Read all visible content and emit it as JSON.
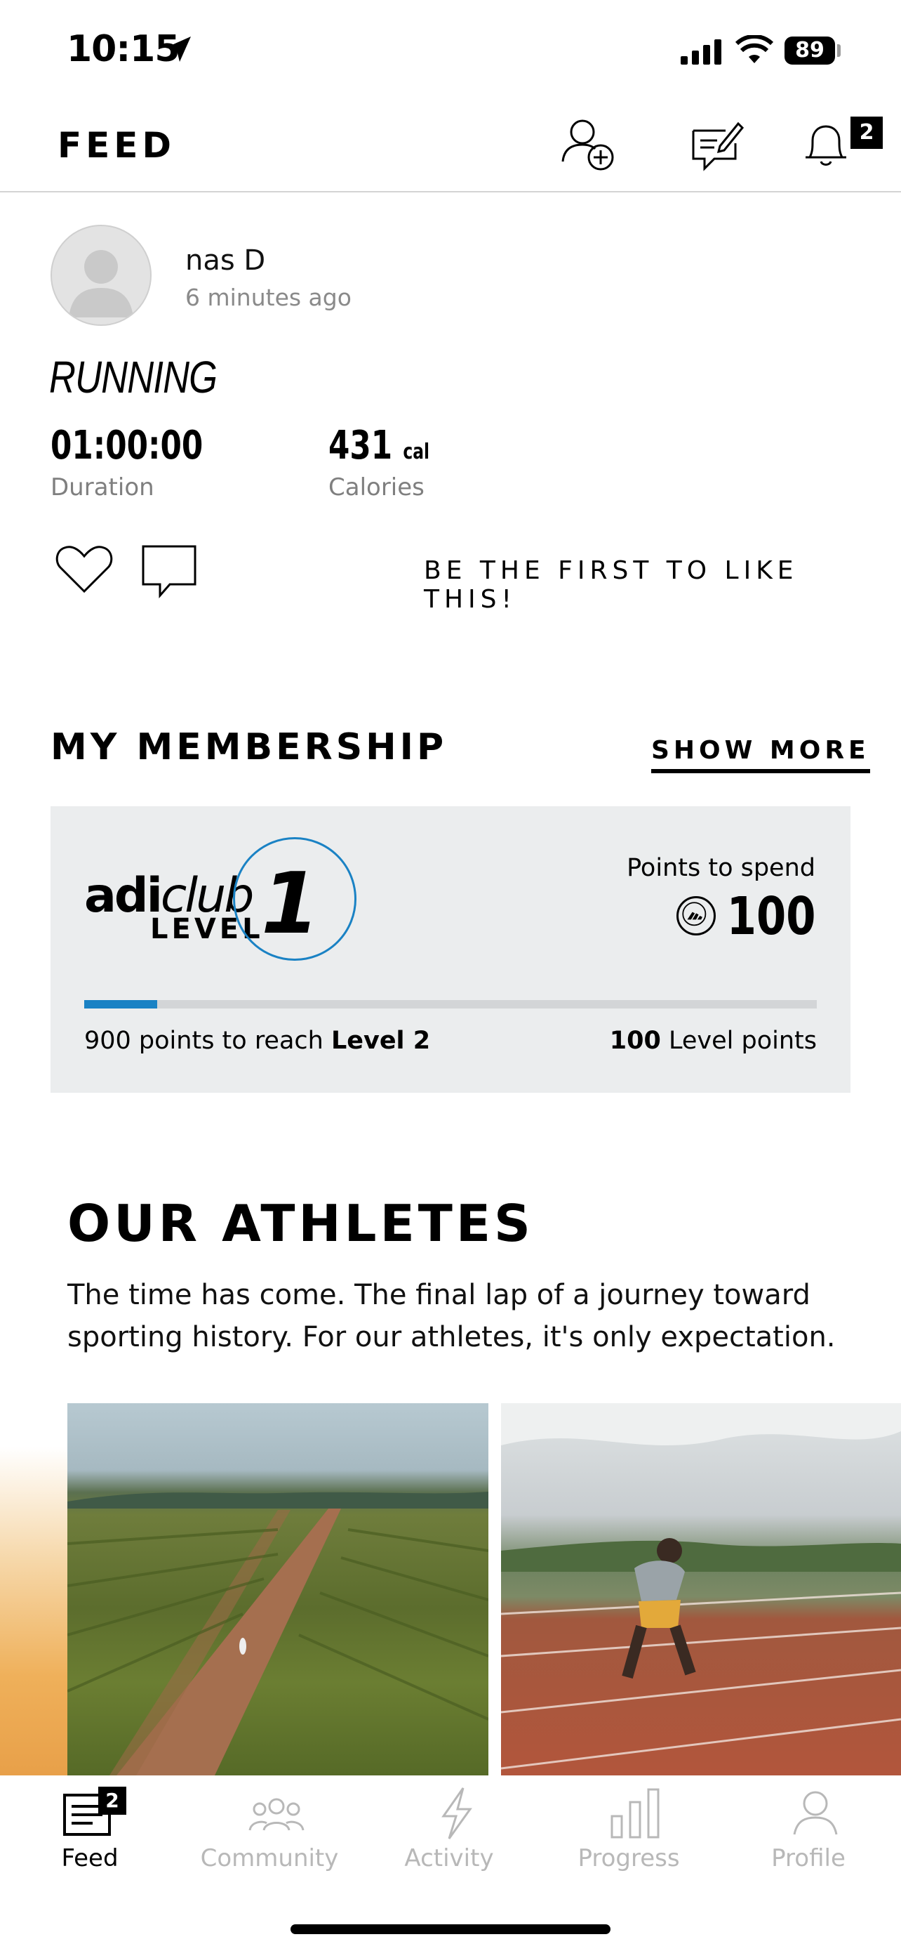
{
  "status_bar": {
    "time": "10:15",
    "battery": "89"
  },
  "header": {
    "title": "FEED",
    "notification_count": "2"
  },
  "post": {
    "username": "nas D",
    "time_ago": "6 minutes ago",
    "activity": "RUNNING",
    "duration_value": "01:00:00",
    "duration_label": "Duration",
    "calories_value": "431",
    "calories_unit": "cal",
    "calories_label": "Calories",
    "like_prompt": "BE THE FIRST TO LIKE THIS!"
  },
  "membership": {
    "title": "MY MEMBERSHIP",
    "show_more": "SHOW MORE",
    "brand_adi": "adi",
    "brand_club": "club",
    "level_word": "LEVEL",
    "level_number": "1",
    "points_label": "Points to spend",
    "points_value": "100",
    "progress_fraction": 0.1,
    "progress_left_prefix": "900 points to reach ",
    "progress_left_bold": "Level 2",
    "progress_right_bold": "100",
    "progress_right_suffix": " Level points",
    "accent_color": "#1a82c4"
  },
  "athletes": {
    "title": "OUR ATHLETES",
    "description": "The time has come. The final lap of a journey toward sporting history. For our athletes, it's only expectation."
  },
  "tabs": [
    {
      "label": "Feed",
      "icon": "feed-icon",
      "active": true,
      "badge": "2"
    },
    {
      "label": "Community",
      "icon": "community-icon",
      "active": false
    },
    {
      "label": "Activity",
      "icon": "lightning-icon",
      "active": false
    },
    {
      "label": "Progress",
      "icon": "bar-chart-icon",
      "active": false
    },
    {
      "label": "Profile",
      "icon": "profile-icon",
      "active": false
    }
  ]
}
